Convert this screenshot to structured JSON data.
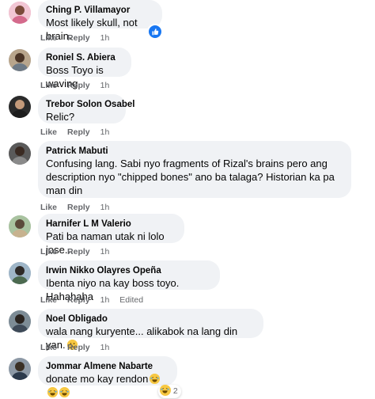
{
  "actions": {
    "like": "Like",
    "reply": "Reply"
  },
  "comments": [
    {
      "author": "Ching P. Villamayor",
      "text": "Most likely skull, not brain.",
      "time": "1h",
      "edited": ""
    },
    {
      "author": "Roniel S. Abiera",
      "text": "Boss Toyo is waving",
      "time": "1h",
      "edited": ""
    },
    {
      "author": "Trebor Solon Osabel",
      "text": "Relic?",
      "time": "1h",
      "edited": ""
    },
    {
      "author": "Patrick Mabuti",
      "text": "Confusing lang. Sabi nyo fragments of Rizal's brains pero ang description nyo \"chipped bones\" ano ba talaga? Historian ka pa man din",
      "time": "1h",
      "edited": ""
    },
    {
      "author": "Harnifer L M Valerio",
      "text": "Pati ba naman utak ni lolo jose...",
      "time": "1h",
      "edited": ""
    },
    {
      "author": "Irwin Nikko Olayres Opeña",
      "text": "Ibenta niyo na kay boss toyo. Hahahaha",
      "time": "1h",
      "edited": "Edited"
    },
    {
      "author": "Noel Obligado",
      "text": "wala nang kuryente... alikabok na lang din yan.",
      "time": "1h",
      "edited": ""
    },
    {
      "author": "Jommar Almene Nabarte",
      "text": "donate mo kay rendon",
      "time": "",
      "edited": ""
    }
  ],
  "reaction_count": "2",
  "icons": {
    "like_reaction": "thumbs-up-icon",
    "emoji": "laughing-emoji-icon",
    "sad_emoji": "neutral-emoji-icon"
  },
  "colors": {
    "bubble": "#f0f2f5",
    "meta": "#65676b",
    "like_blue": "#1877f2"
  }
}
